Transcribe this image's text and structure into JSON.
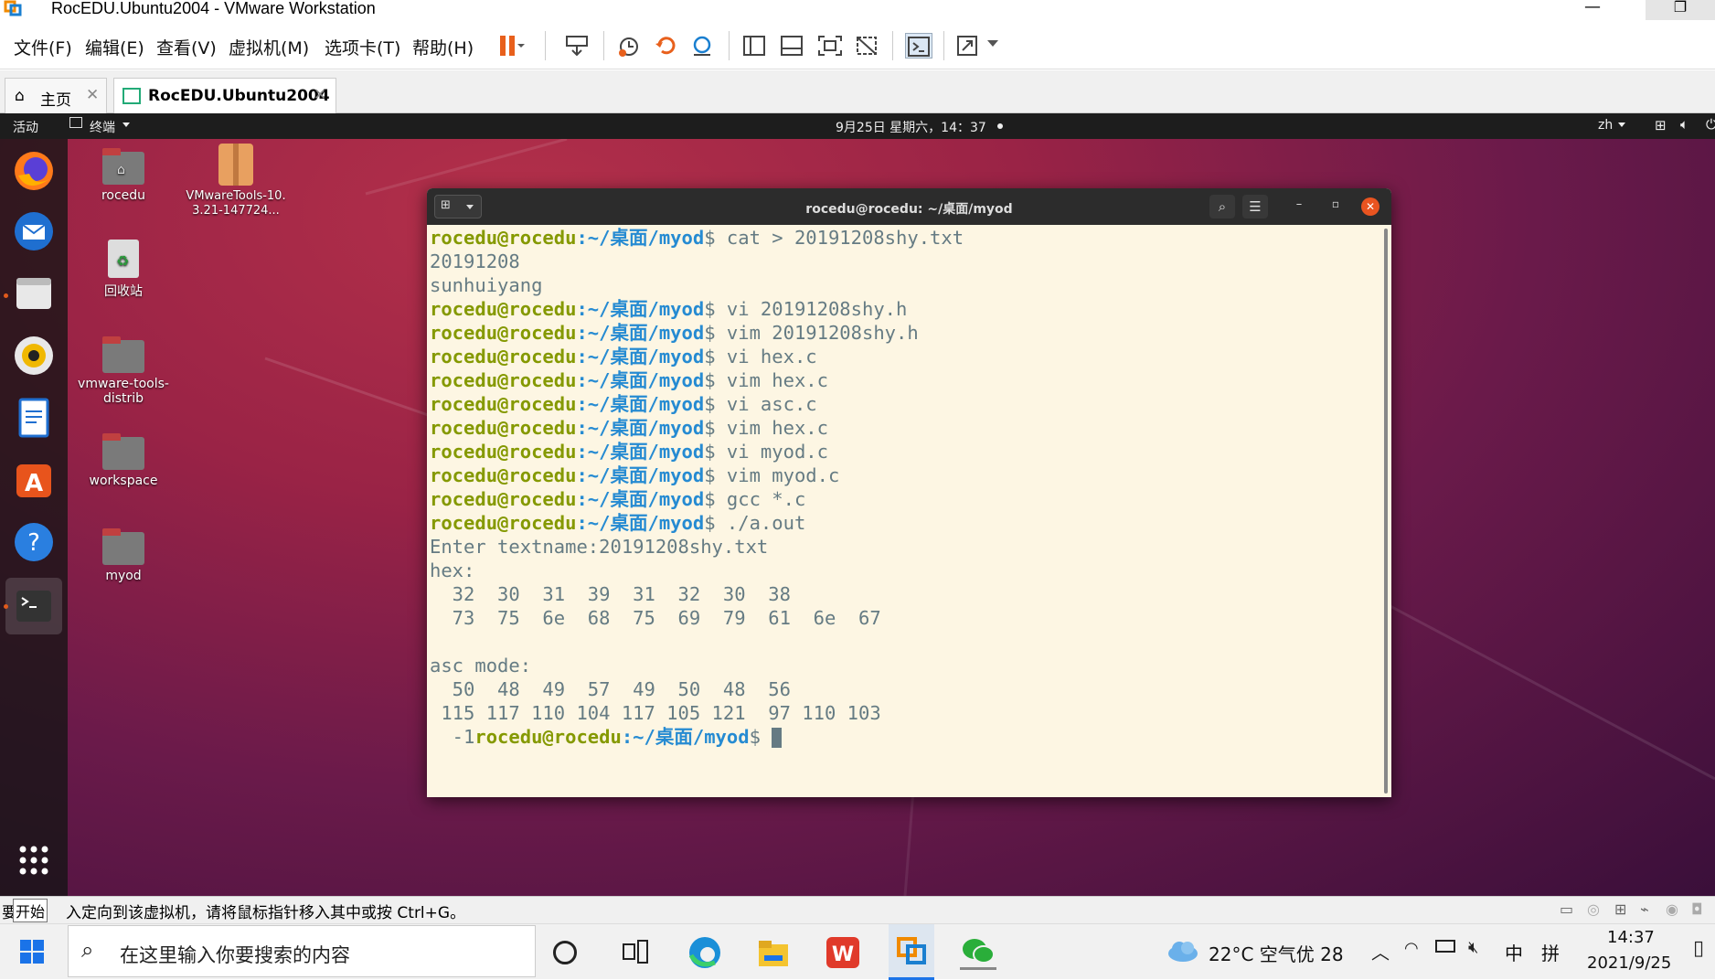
{
  "window": {
    "title": "RocEDU.Ubuntu2004 - VMware Workstation",
    "minimize_glyph": "—",
    "restore_glyph": "❐"
  },
  "menu": {
    "items": [
      "文件(F)",
      "编辑(E)",
      "查看(V)",
      "虚拟机(M)",
      "选项卡(T)",
      "帮助(H)"
    ]
  },
  "tabs": [
    {
      "label": "主页"
    },
    {
      "label": "RocEDU.Ubuntu2004"
    }
  ],
  "ubuntu_panel": {
    "activities": "活动",
    "app_menu": "终端",
    "clock": "9月25日 星期六，14：37",
    "lang": "zh"
  },
  "desktop_icons": [
    {
      "label": "rocedu"
    },
    {
      "label": "VMwareTools-10.3.21-147724..."
    },
    {
      "label": "回收站"
    },
    {
      "label": "vmware-tools-distrib"
    },
    {
      "label": "workspace"
    },
    {
      "label": "myod"
    }
  ],
  "terminal": {
    "title": "rocedu@rocedu: ~/桌面/myod",
    "prompt_user": "rocedu@rocedu",
    "prompt_path": ":~/桌面/myod",
    "prompt_symbol": "$",
    "lines": [
      {
        "type": "cmd",
        "cmd": " cat > 20191208shy.txt"
      },
      {
        "type": "out",
        "text": "20191208"
      },
      {
        "type": "out",
        "text": "sunhuiyang"
      },
      {
        "type": "cmd",
        "cmd": " vi 20191208shy.h"
      },
      {
        "type": "cmd",
        "cmd": " vim 20191208shy.h"
      },
      {
        "type": "cmd",
        "cmd": " vi hex.c"
      },
      {
        "type": "cmd",
        "cmd": " vim hex.c"
      },
      {
        "type": "cmd",
        "cmd": " vi asc.c"
      },
      {
        "type": "cmd",
        "cmd": " vim hex.c"
      },
      {
        "type": "cmd",
        "cmd": " vi myod.c"
      },
      {
        "type": "cmd",
        "cmd": " vim myod.c"
      },
      {
        "type": "cmd",
        "cmd": " gcc *.c"
      },
      {
        "type": "cmd",
        "cmd": " ./a.out"
      },
      {
        "type": "out",
        "text": "Enter textname:20191208shy.txt"
      },
      {
        "type": "out",
        "text": "hex:"
      },
      {
        "type": "out",
        "text": "  32  30  31  39  31  32  30  38"
      },
      {
        "type": "out",
        "text": "  73  75  6e  68  75  69  79  61  6e  67"
      },
      {
        "type": "out",
        "text": ""
      },
      {
        "type": "out",
        "text": "asc mode:"
      },
      {
        "type": "out",
        "text": "  50  48  49  57  49  50  48  56"
      },
      {
        "type": "out",
        "text": " 115 117 110 104 117 105 121  97 110 103"
      },
      {
        "type": "final",
        "prefix": "  -1",
        "cmd": " "
      }
    ]
  },
  "statusbar": {
    "tooltip": "开始",
    "message_prefix": "要",
    "message": "入定向到该虚拟机，请将鼠标指针移入其中或按 Ctrl+G。"
  },
  "taskbar": {
    "search_placeholder": "在这里输入你要搜索的内容",
    "weather": "22°C  空气优 28",
    "ime_lang": "中",
    "ime_mode": "拼",
    "time": "14:37",
    "date": "2021/9/25"
  },
  "colors": {
    "prompt_user": "#859900",
    "prompt_path": "#268bd2",
    "terminal_bg": "#fdf6e3",
    "terminal_fg": "#657b83"
  }
}
